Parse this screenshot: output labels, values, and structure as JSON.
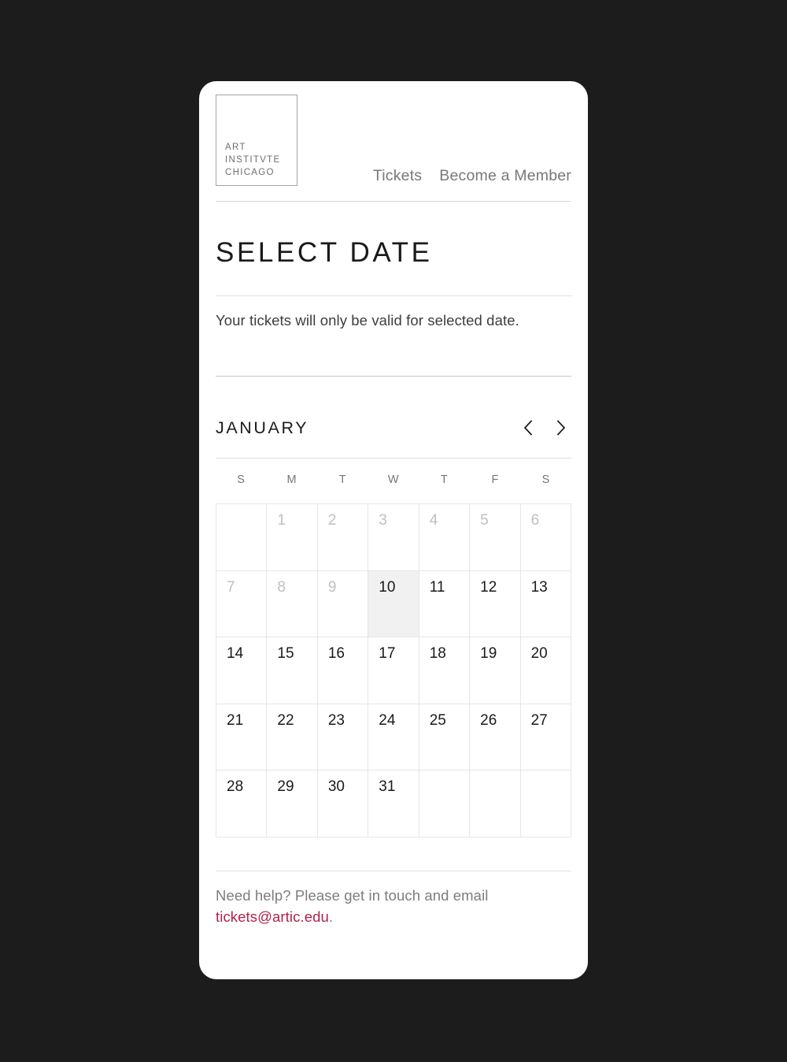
{
  "header": {
    "logo_lines": "ART\nINSTITVTE\nCHICAGO",
    "logo_alt": "Art Institute Chicago",
    "nav": [
      {
        "label": "Tickets"
      },
      {
        "label": "Become a Member"
      }
    ]
  },
  "main": {
    "title": "SELECT DATE",
    "intro": "Your tickets will only be valid for selected date."
  },
  "calendar": {
    "month": "JANUARY",
    "prev_icon": "chevron-left-icon",
    "next_icon": "chevron-right-icon",
    "weekdays": [
      "S",
      "M",
      "T",
      "W",
      "T",
      "F",
      "S"
    ],
    "cells": [
      {
        "label": "",
        "state": "empty"
      },
      {
        "label": "1",
        "state": "disabled"
      },
      {
        "label": "2",
        "state": "disabled"
      },
      {
        "label": "3",
        "state": "disabled"
      },
      {
        "label": "4",
        "state": "disabled"
      },
      {
        "label": "5",
        "state": "disabled"
      },
      {
        "label": "6",
        "state": "disabled"
      },
      {
        "label": "7",
        "state": "disabled"
      },
      {
        "label": "8",
        "state": "disabled"
      },
      {
        "label": "9",
        "state": "disabled"
      },
      {
        "label": "10",
        "state": "highlight"
      },
      {
        "label": "11",
        "state": "available"
      },
      {
        "label": "12",
        "state": "available"
      },
      {
        "label": "13",
        "state": "available"
      },
      {
        "label": "14",
        "state": "available"
      },
      {
        "label": "15",
        "state": "available"
      },
      {
        "label": "16",
        "state": "available"
      },
      {
        "label": "17",
        "state": "available"
      },
      {
        "label": "18",
        "state": "available"
      },
      {
        "label": "19",
        "state": "available"
      },
      {
        "label": "20",
        "state": "available"
      },
      {
        "label": "21",
        "state": "available"
      },
      {
        "label": "22",
        "state": "available"
      },
      {
        "label": "23",
        "state": "available"
      },
      {
        "label": "24",
        "state": "available"
      },
      {
        "label": "25",
        "state": "available"
      },
      {
        "label": "26",
        "state": "available"
      },
      {
        "label": "27",
        "state": "available"
      },
      {
        "label": "28",
        "state": "available"
      },
      {
        "label": "29",
        "state": "available"
      },
      {
        "label": "30",
        "state": "available"
      },
      {
        "label": "31",
        "state": "available"
      },
      {
        "label": "",
        "state": "empty"
      },
      {
        "label": "",
        "state": "empty"
      },
      {
        "label": "",
        "state": "empty"
      }
    ]
  },
  "footer": {
    "help_text": "Need help? Please get in touch and email",
    "email": "tickets@artic.edu",
    "period": "."
  },
  "colors": {
    "page_background": "#1c1c1c",
    "card_background": "#ffffff",
    "accent_link": "#b0224a",
    "text_primary": "#1a1a1a",
    "text_muted": "#7d7d7d",
    "disabled_day": "#bfbfbf",
    "highlight_cell": "#f1f1f1",
    "rule": "#e2e2e2"
  }
}
